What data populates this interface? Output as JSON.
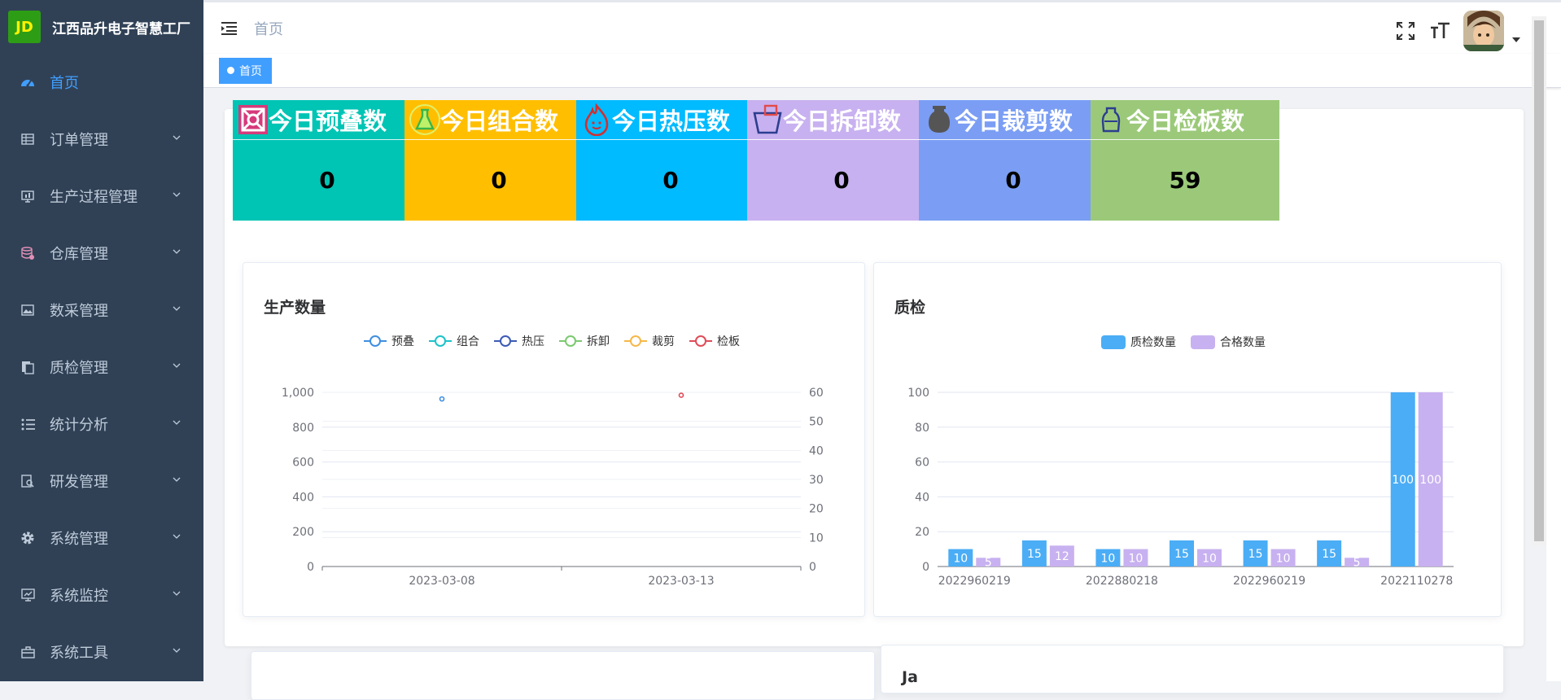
{
  "app": {
    "title": "江西品升电子智慧工厂",
    "logo_text": "JD"
  },
  "sidebar": {
    "items": [
      {
        "label": "首页",
        "icon": "dashboard-icon",
        "active": true
      },
      {
        "label": "订单管理",
        "icon": "table-icon"
      },
      {
        "label": "生产过程管理",
        "icon": "monitor-icon"
      },
      {
        "label": "仓库管理",
        "icon": "database-icon"
      },
      {
        "label": "数采管理",
        "icon": "image-icon"
      },
      {
        "label": "质检管理",
        "icon": "documents-icon"
      },
      {
        "label": "统计分析",
        "icon": "list-icon"
      },
      {
        "label": "研发管理",
        "icon": "research-icon"
      },
      {
        "label": "系统管理",
        "icon": "gear-icon"
      },
      {
        "label": "系统监控",
        "icon": "monitor-chart-icon"
      },
      {
        "label": "系统工具",
        "icon": "toolbox-icon"
      }
    ]
  },
  "navbar": {
    "breadcrumb": "首页"
  },
  "tags": [
    {
      "label": "首页"
    }
  ],
  "stats": [
    {
      "title": "今日预叠数",
      "value": "0",
      "color": "#00c4b4",
      "icon": "stack-icon"
    },
    {
      "title": "今日组合数",
      "value": "0",
      "color": "#ffbf00",
      "icon": "flask-icon"
    },
    {
      "title": "今日热压数",
      "value": "0",
      "color": "#00bbff",
      "icon": "flame-icon"
    },
    {
      "title": "今日拆卸数",
      "value": "0",
      "color": "#c8b1f0",
      "icon": "basket-icon"
    },
    {
      "title": "今日裁剪数",
      "value": "0",
      "color": "#7b9ef4",
      "icon": "vase-icon"
    },
    {
      "title": "今日检板数",
      "value": "59",
      "color": "#9bc979",
      "icon": "jar-icon"
    }
  ],
  "production_card": {
    "title": "生产数量"
  },
  "quality_card": {
    "title": "质检"
  },
  "bottom_card": {
    "title": "Ja"
  },
  "chart_data": [
    {
      "type": "line",
      "title": "生产数量",
      "legend": [
        "预叠",
        "组合",
        "热压",
        "拆卸",
        "裁剪",
        "检板"
      ],
      "legend_colors": [
        "#3f8fe0",
        "#1cc3c9",
        "#3d5bb5",
        "#7bc96f",
        "#f5b84b",
        "#e04c59"
      ],
      "categories": [
        "2023-03-08",
        "2023-03-13"
      ],
      "y_left": {
        "min": 0,
        "max": 1000,
        "ticks": [
          0,
          200,
          400,
          600,
          800,
          1000
        ],
        "tick_labels": [
          "0",
          "200",
          "400",
          "600",
          "800",
          "1,000"
        ]
      },
      "y_right": {
        "min": 0,
        "max": 60,
        "ticks": [
          0,
          10,
          20,
          30,
          40,
          50,
          60
        ]
      },
      "series": [
        {
          "name": "预叠",
          "axis": "left",
          "values": [
            962,
            null
          ]
        },
        {
          "name": "检板",
          "axis": "right",
          "values": [
            null,
            59
          ]
        }
      ],
      "legend_position": "top-center"
    },
    {
      "type": "bar",
      "title": "质检",
      "legend": [
        "质检数量",
        "合格数量"
      ],
      "legend_colors": [
        "#4badf5",
        "#c8b1f0"
      ],
      "x_tick_labels": [
        "2022960219",
        "2022880218",
        "2022960219",
        "2022110278"
      ],
      "ylim": [
        0,
        100
      ],
      "y_ticks": [
        0,
        20,
        40,
        60,
        80,
        100
      ],
      "series": [
        {
          "name": "质检数量",
          "values": [
            10,
            15,
            10,
            15,
            15,
            15,
            100
          ]
        },
        {
          "name": "合格数量",
          "values": [
            5,
            12,
            10,
            10,
            10,
            5,
            100
          ]
        }
      ],
      "legend_position": "top-center"
    }
  ]
}
